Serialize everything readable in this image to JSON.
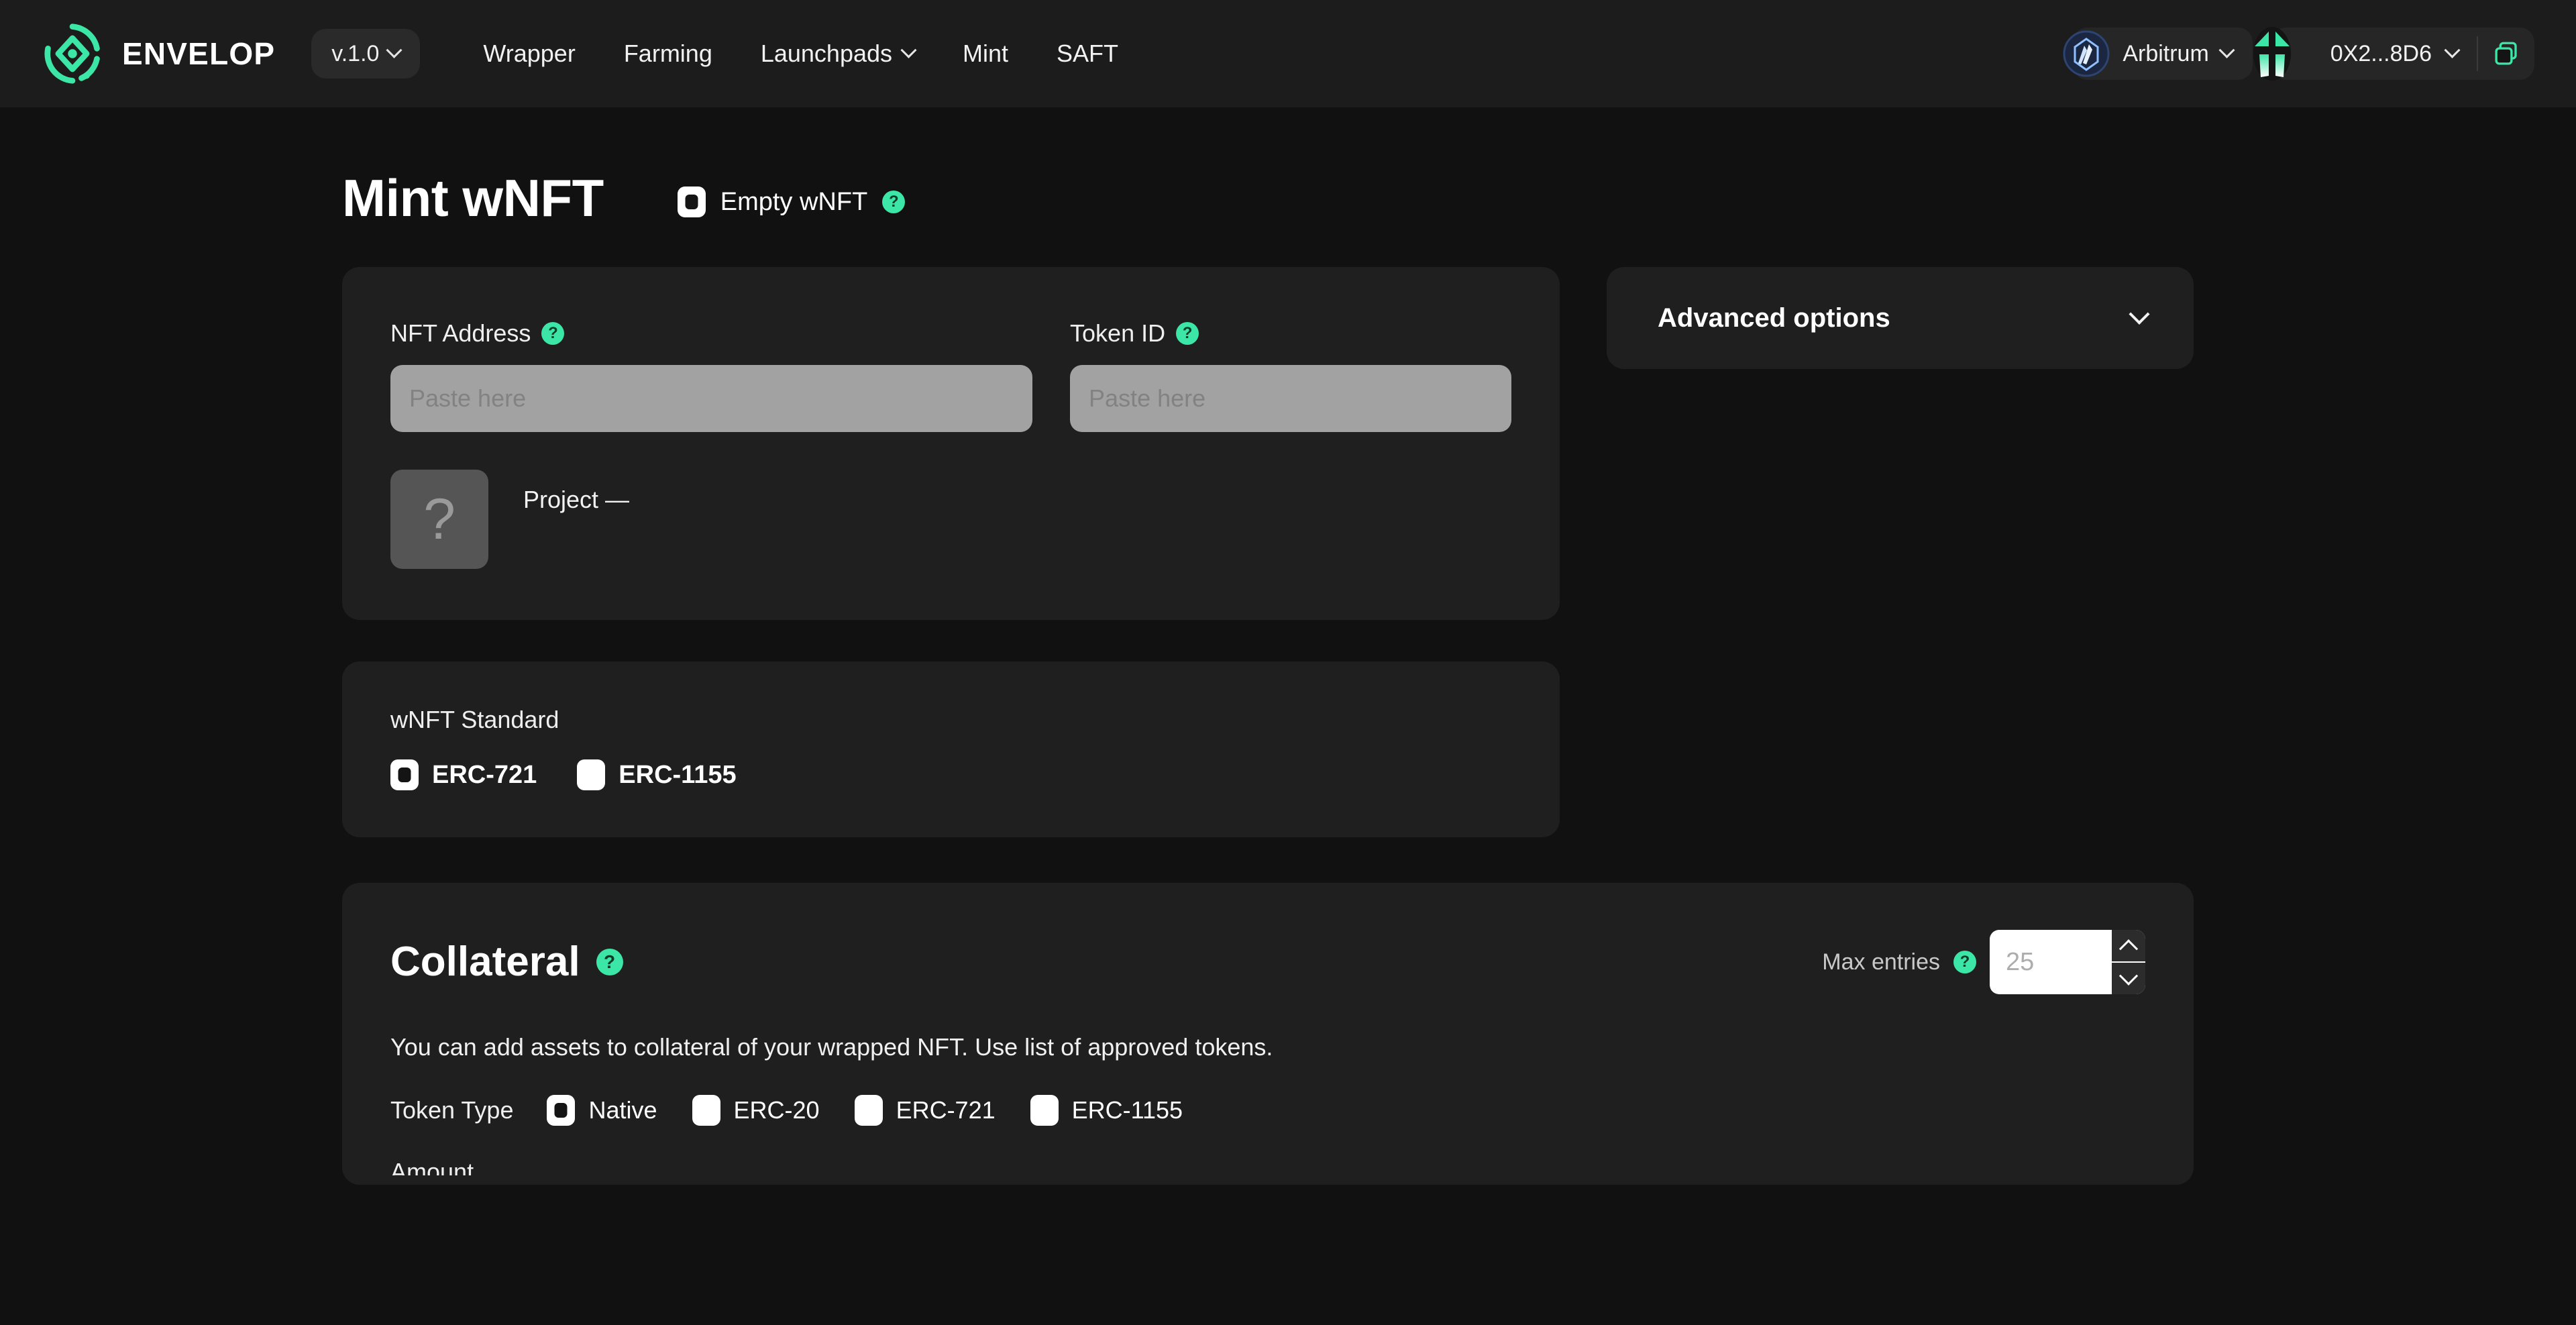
{
  "brand": {
    "name": "ENVELOP",
    "logo_icon": "envelop-logo-icon",
    "version_label": "v.1.0"
  },
  "nav": {
    "items": [
      {
        "label": "Wrapper",
        "has_dropdown": false
      },
      {
        "label": "Farming",
        "has_dropdown": false
      },
      {
        "label": "Launchpads",
        "has_dropdown": true
      },
      {
        "label": "Mint",
        "has_dropdown": false
      },
      {
        "label": "SAFT",
        "has_dropdown": false
      }
    ]
  },
  "header_right": {
    "network": {
      "label": "Arbitrum",
      "icon": "arbitrum-icon"
    },
    "wallet": {
      "address": "0X2...8D6",
      "avatar_icon": "wallet-avatar-icon"
    },
    "copy_icon": "copy-icon"
  },
  "page": {
    "title": "Mint wNFT",
    "empty_wnft": {
      "label": "Empty wNFT",
      "checked": false,
      "help_icon": "help-icon"
    }
  },
  "form": {
    "nft_address": {
      "label": "NFT Address",
      "placeholder": "Paste here",
      "value": "",
      "help_icon": "help-icon"
    },
    "token_id": {
      "label": "Token ID",
      "placeholder": "Paste here",
      "value": "",
      "help_icon": "help-icon"
    },
    "project": {
      "thumb_glyph": "?",
      "label": "Project —"
    }
  },
  "advanced": {
    "title": "Advanced options",
    "chevron_icon": "chevron-down-icon"
  },
  "standard": {
    "label": "wNFT Standard",
    "options": [
      {
        "label": "ERC-721",
        "selected": true
      },
      {
        "label": "ERC-1155",
        "selected": false
      }
    ]
  },
  "collateral": {
    "title": "Collateral",
    "help_icon": "help-icon",
    "max_entries": {
      "label": "Max entries",
      "placeholder": "25",
      "value": "",
      "help_icon": "help-icon",
      "increment_icon": "chevron-up-icon",
      "decrement_icon": "chevron-down-icon"
    },
    "description": "You can add assets to collateral of your wrapped NFT. Use list of approved tokens.",
    "token_type": {
      "label": "Token Type",
      "options": [
        {
          "label": "Native",
          "selected": true
        },
        {
          "label": "ERC-20",
          "selected": false
        },
        {
          "label": "ERC-721",
          "selected": false
        },
        {
          "label": "ERC-1155",
          "selected": false
        }
      ]
    },
    "next_section_peek": "Amount"
  },
  "colors": {
    "accent": "#3ce6a6",
    "page_bg": "#111111",
    "header_bg": "#1c1c1c",
    "card_bg": "#1f1f1f",
    "input_bg": "#a2a2a2"
  }
}
